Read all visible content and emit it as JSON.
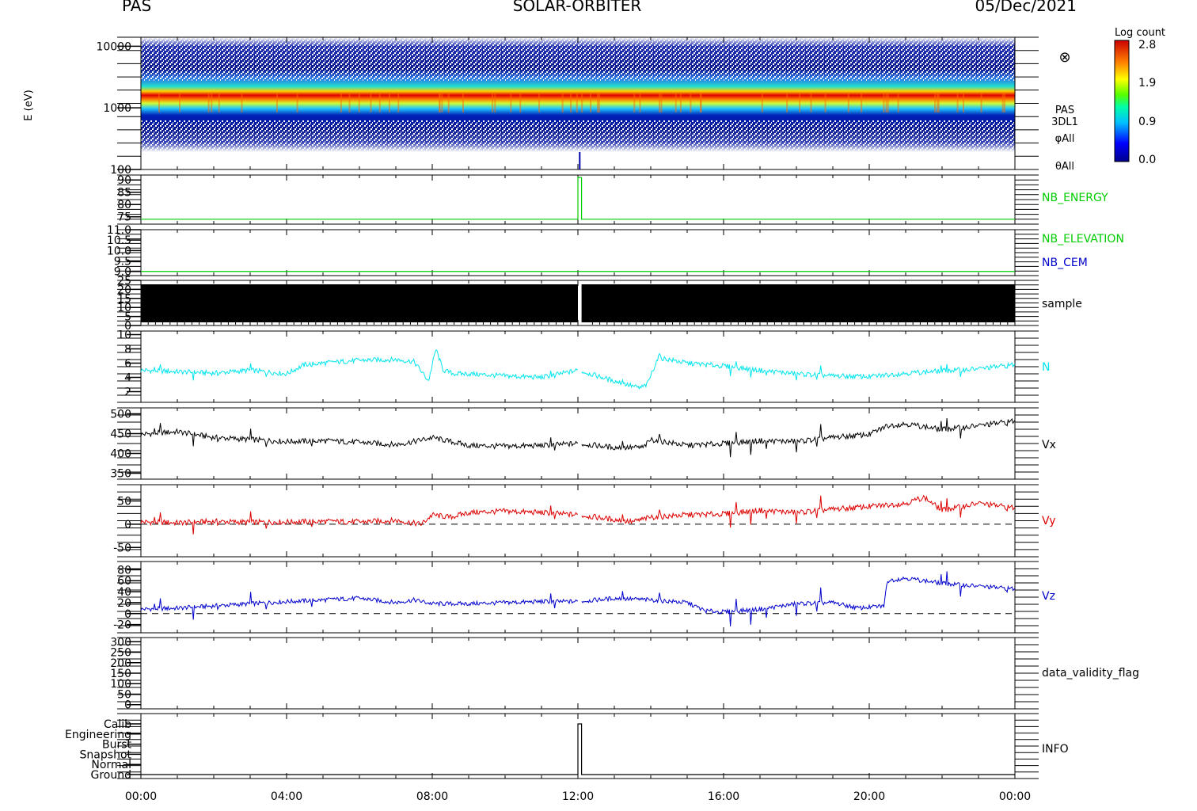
{
  "header": {
    "left": "PAS",
    "center": "SOLAR-ORBITER",
    "right": "05/Dec/2021"
  },
  "colorbar": {
    "title": "Log count",
    "ticks": [
      "2.8",
      "1.9",
      "0.9",
      "0.0"
    ]
  },
  "xaxis": {
    "tick_labels": [
      "00:00",
      "04:00",
      "08:00",
      "12:00",
      "16:00",
      "20:00",
      "00:00"
    ]
  },
  "chart_data": [
    {
      "type": "heatmap",
      "panel": "spectrogram",
      "ylabel": "E (eV)",
      "yscale": "log",
      "ylim": [
        100,
        14000
      ],
      "yticks": [
        100,
        1000,
        10000
      ],
      "ytick_labels": [
        "100",
        "1000",
        "10000"
      ],
      "right_labels": [
        "PAS",
        "3DL1",
        "φAll",
        "θAll"
      ],
      "cross_symbol": "⊗",
      "colorbar_range": [
        0.0,
        2.8
      ],
      "peak_energy_eV": 1150
    },
    {
      "type": "line",
      "panel": "nb_energy",
      "ylim": [
        72,
        92
      ],
      "yticks": [
        75,
        80,
        85,
        90
      ],
      "ytick_labels": [
        "75",
        "80",
        "85",
        "90"
      ],
      "series": [
        {
          "name": "NB_ENERGY",
          "color": "#00cc00",
          "x": [
            0,
            12.0,
            12.0,
            12.1,
            12.1,
            24
          ],
          "values": [
            74,
            74,
            91,
            91,
            74,
            74
          ]
        }
      ]
    },
    {
      "type": "line",
      "panel": "nb_elevation",
      "ylim": [
        8.8,
        11.0
      ],
      "yticks": [
        9.0,
        9.5,
        10.0,
        10.5,
        11.0
      ],
      "ytick_labels": [
        "9.0",
        "9.5",
        "10.0",
        "10.5",
        "11.0"
      ],
      "series": [
        {
          "name": "NB_ELEVATION",
          "color": "#00cc00",
          "x": [
            0,
            24
          ],
          "values": [
            9.0,
            9.0
          ]
        },
        {
          "name": "NB_CEM",
          "color": "#0000cc",
          "x": [],
          "values": []
        }
      ]
    },
    {
      "type": "line",
      "panel": "sample",
      "ylim": [
        0,
        25
      ],
      "yticks": [
        0,
        5,
        10,
        15,
        20,
        25
      ],
      "ytick_labels": [
        "0",
        "5",
        "10",
        "15",
        "20",
        "25"
      ],
      "series": [
        {
          "name": "sample",
          "color": "#000000",
          "range": [
            0,
            24
          ],
          "gap": [
            12.0,
            12.1
          ]
        }
      ]
    },
    {
      "type": "line",
      "panel": "density",
      "ylim": [
        0.5,
        10.5
      ],
      "yticks": [
        2,
        4,
        6,
        8,
        10
      ],
      "ytick_labels": [
        "2",
        "4",
        "6",
        "8",
        "10"
      ],
      "series": [
        {
          "name": "N",
          "color": "#00e5ee",
          "x": [
            0,
            1,
            2,
            3,
            4,
            4.5,
            5,
            6,
            7,
            7.5,
            7.9,
            8.1,
            8.3,
            8.6,
            9,
            10,
            11,
            12,
            13,
            13.7,
            13.9,
            14.2,
            15,
            16,
            17,
            18,
            19,
            20,
            21,
            22,
            23,
            24
          ],
          "values": [
            5.0,
            4.8,
            4.6,
            5.0,
            4.5,
            5.8,
            6.0,
            6.4,
            6.5,
            6.2,
            3.5,
            8.0,
            5.0,
            4.5,
            4.5,
            4.2,
            4.0,
            5.0,
            3.5,
            2.5,
            3.0,
            6.8,
            6.0,
            5.6,
            5.0,
            4.5,
            4.2,
            4.1,
            4.6,
            4.9,
            5.2,
            5.8
          ]
        }
      ]
    },
    {
      "type": "line",
      "panel": "vx",
      "ylim": [
        335,
        515
      ],
      "yticks": [
        350,
        400,
        450,
        500
      ],
      "ytick_labels": [
        "350",
        "400",
        "450",
        "500"
      ],
      "series": [
        {
          "name": "Vx",
          "color": "#000000",
          "x": [
            0,
            1,
            2,
            3,
            4,
            5,
            6,
            7,
            7.5,
            8,
            9,
            10,
            11,
            12,
            13,
            13.8,
            14,
            15,
            16,
            17,
            18,
            19,
            20,
            20.5,
            21,
            22,
            23,
            24
          ],
          "values": [
            448,
            455,
            440,
            435,
            430,
            432,
            428,
            422,
            430,
            440,
            420,
            418,
            420,
            425,
            415,
            415,
            435,
            420,
            425,
            432,
            430,
            440,
            448,
            470,
            475,
            460,
            470,
            482
          ]
        }
      ]
    },
    {
      "type": "line",
      "panel": "vy",
      "ylim": [
        -70,
        85
      ],
      "yticks": [
        -50,
        0,
        50
      ],
      "ytick_labels": [
        "-50",
        "0",
        "50"
      ],
      "zero_line": true,
      "series": [
        {
          "name": "Vy",
          "color": "#dd0000",
          "x": [
            0,
            1,
            2,
            3,
            4,
            5,
            6,
            7,
            7.7,
            8,
            8.5,
            9,
            10,
            11,
            12,
            13,
            13.5,
            14,
            15,
            16,
            17,
            18,
            19,
            20,
            21,
            21.5,
            22,
            23,
            24
          ],
          "values": [
            5,
            3,
            6,
            4,
            5,
            6,
            5,
            8,
            0,
            20,
            15,
            25,
            28,
            25,
            20,
            10,
            5,
            15,
            20,
            22,
            30,
            25,
            32,
            38,
            45,
            58,
            30,
            45,
            35
          ]
        }
      ]
    },
    {
      "type": "line",
      "panel": "vz",
      "ylim": [
        -35,
        95
      ],
      "yticks": [
        -20,
        0,
        20,
        40,
        60,
        80
      ],
      "ytick_labels": [
        "-20",
        "0",
        "20",
        "40",
        "60",
        "80"
      ],
      "zero_line": true,
      "series": [
        {
          "name": "Vz",
          "color": "#0000cc",
          "x": [
            0,
            1,
            2,
            3,
            4,
            5,
            6,
            7,
            7.5,
            8,
            9,
            10,
            11,
            12,
            13,
            14,
            15,
            15.5,
            16,
            17,
            18,
            19,
            19.7,
            20.4,
            20.5,
            21,
            22,
            23,
            24
          ],
          "values": [
            8,
            10,
            14,
            18,
            22,
            25,
            28,
            20,
            25,
            18,
            18,
            20,
            22,
            22,
            28,
            25,
            20,
            5,
            3,
            8,
            18,
            20,
            10,
            14,
            60,
            65,
            55,
            50,
            45
          ]
        }
      ]
    },
    {
      "type": "line",
      "panel": "data_validity_flag",
      "ylim": [
        -20,
        320
      ],
      "yticks": [
        0,
        50,
        100,
        150,
        200,
        250,
        300
      ],
      "ytick_labels": [
        "0",
        "50",
        "100",
        "150",
        "200",
        "250",
        "300"
      ],
      "series": [
        {
          "name": "data_validity_flag",
          "color": "#000000",
          "x": [],
          "values": []
        }
      ]
    },
    {
      "type": "line",
      "panel": "info",
      "categories": [
        "Ground",
        "Normal",
        "Snapshot",
        "Burst",
        "Engineering",
        "Calib"
      ],
      "series": [
        {
          "name": "INFO",
          "color": "#000000",
          "x": [
            0,
            12.0,
            12.0,
            12.1,
            12.1,
            24
          ],
          "values": [
            0,
            0,
            5,
            5,
            0,
            0
          ]
        }
      ]
    }
  ]
}
